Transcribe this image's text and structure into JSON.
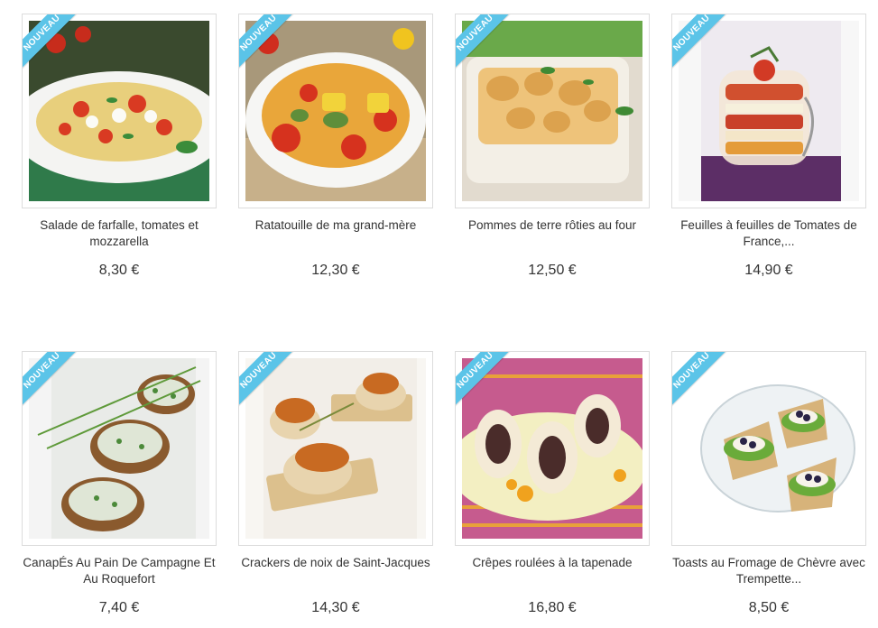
{
  "badge_label": "NOUVEAU",
  "products": [
    {
      "name": "Salade de farfalle, tomates et mozzarella",
      "price": "8,30 €"
    },
    {
      "name": "Ratatouille de ma grand-mère",
      "price": "12,30 €"
    },
    {
      "name": "Pommes de terre rôties au four",
      "price": "12,50 €"
    },
    {
      "name": "Feuilles à feuilles de Tomates de France,...",
      "price": "14,90 €"
    },
    {
      "name": "CanapÉs Au Pain De Campagne Et Au Roquefort",
      "price": "7,40 €"
    },
    {
      "name": "Crackers de noix de Saint-Jacques",
      "price": "14,30 €"
    },
    {
      "name": "Crêpes roulées à la tapenade",
      "price": "16,80 €"
    },
    {
      "name": "Toasts au Fromage de Chèvre avec Trempette...",
      "price": "8,50 €"
    }
  ]
}
